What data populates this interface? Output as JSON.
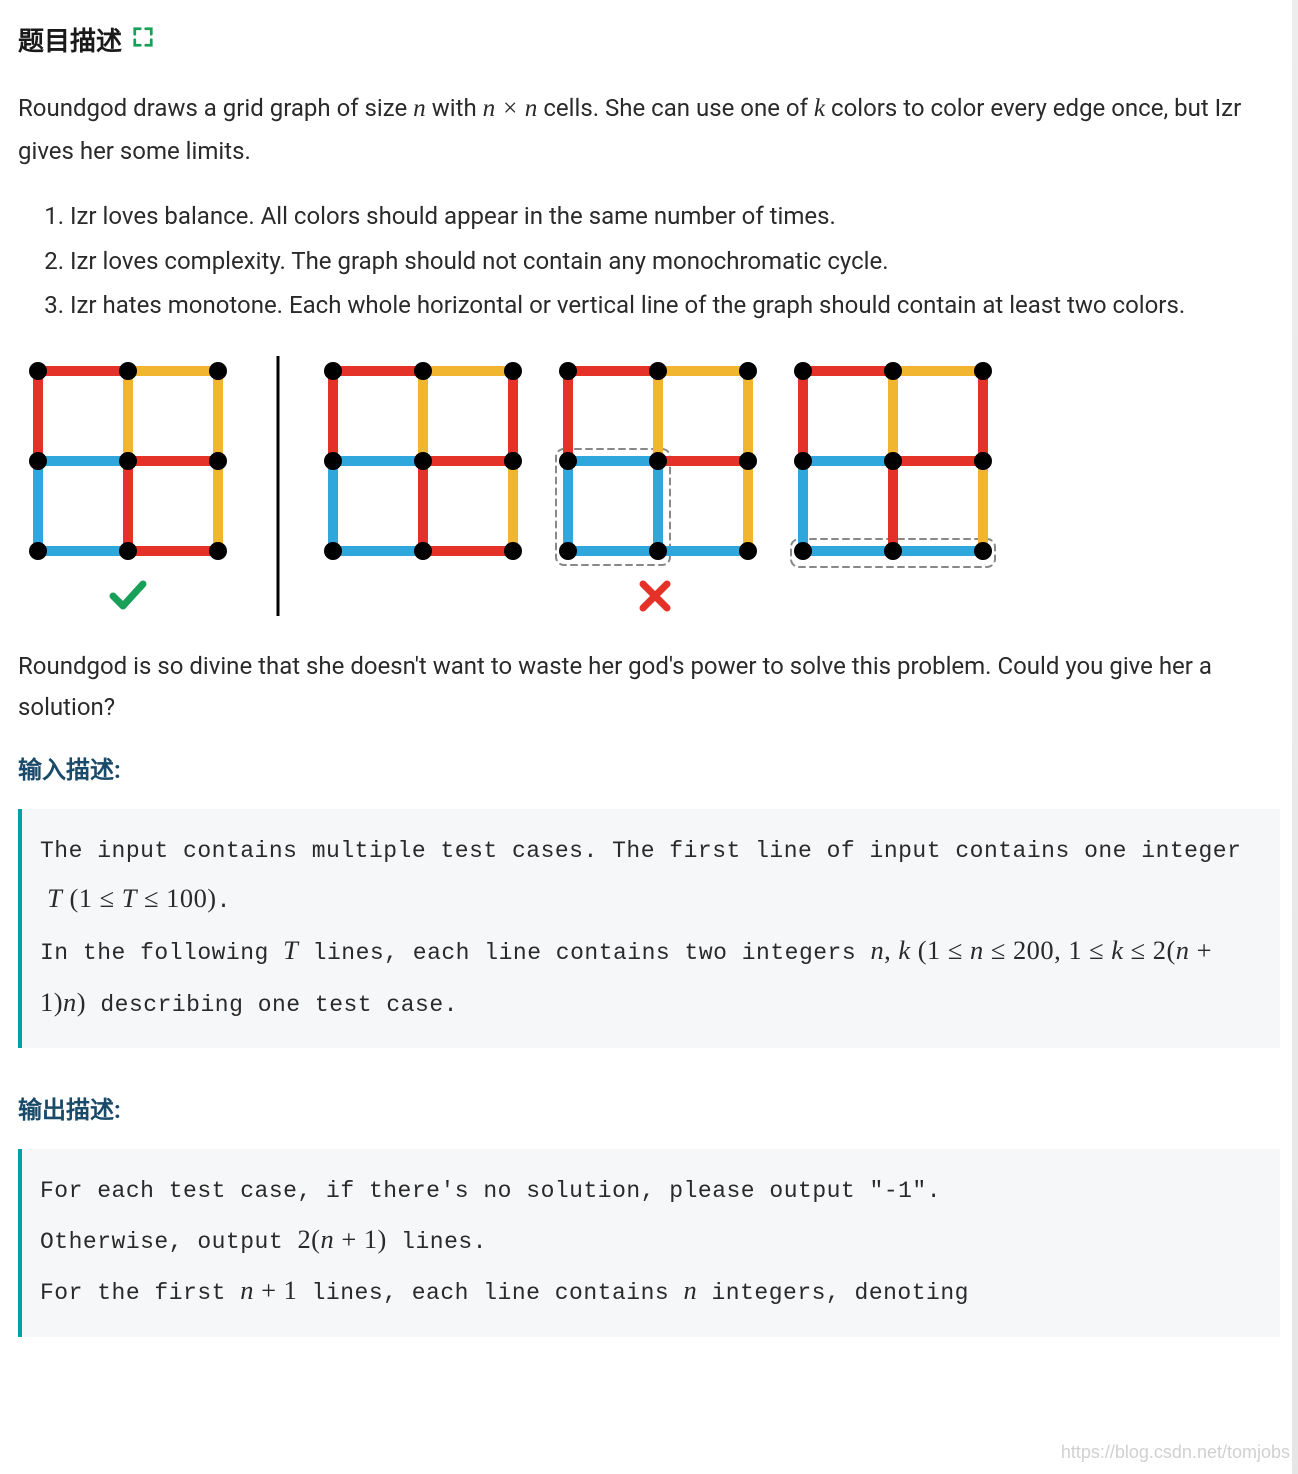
{
  "header": {
    "title": "题目描述"
  },
  "intro": {
    "t1": "Roundgod draws a grid graph of size ",
    "t2": " with ",
    "t3": " cells. She can use one of ",
    "t4": " colors to color every edge once, but Izr gives her some limits.",
    "n": "n",
    "times": "n × n",
    "k": "k"
  },
  "rules": [
    "Izr loves balance. All colors should appear in the same number of times.",
    "Izr loves complexity. The graph should not contain any monochromatic cycle.",
    "Izr hates monotone. Each whole horizontal or vertical line of the graph should contain at least two colors."
  ],
  "after": "Roundgod is so divine that she doesn't want to waste her god's power to solve this problem. Could you give her a solution?",
  "input_heading": "输入描述:",
  "output_heading": "输出描述:",
  "input": {
    "l1a": "The input contains multiple test cases. The first line of input contains one integer ",
    "l1m": "T (1 ≤ T ≤ 100)",
    "l1b": ".",
    "l2a": "In the following ",
    "l2m1": "T",
    "l2b": " lines, each line contains two integers ",
    "l2m2": "n, k (1 ≤ n ≤ 200, 1 ≤ k ≤ 2(n + 1)n)",
    "l2c": " describing one test case."
  },
  "output": {
    "l1": "For each test case, if there's no solution, please output \"-1\".",
    "l2a": "Otherwise, output ",
    "l2m": "2(n + 1)",
    "l2b": " lines.",
    "l3a": "For the first ",
    "l3m1": "n + 1",
    "l3b": " lines, each line contains ",
    "l3m2": "n",
    "l3c": " integers, denoting"
  },
  "watermark": "https://blog.csdn.net/tomjobs",
  "chart_data": {
    "type": "diagram",
    "description": "Four 2x2 grid-graph colorings; leftmost is valid (green check), right group of three is invalid (red X)",
    "colors": {
      "red": "#e43228",
      "yellow": "#f2b530",
      "blue": "#2fa6dc"
    },
    "grids": [
      {
        "label": "valid",
        "h": [
          [
            "red",
            "yellow"
          ],
          [
            "blue",
            "red"
          ],
          [
            "blue",
            "red"
          ]
        ],
        "v": [
          [
            "red",
            "yellow",
            "yellow"
          ],
          [
            "blue",
            "red",
            "yellow"
          ]
        ]
      },
      {
        "label": "invalid-1",
        "h": [
          [
            "red",
            "yellow"
          ],
          [
            "blue",
            "red"
          ],
          [
            "blue",
            "red"
          ]
        ],
        "v": [
          [
            "red",
            "yellow",
            "red"
          ],
          [
            "blue",
            "red",
            "yellow"
          ]
        ]
      },
      {
        "label": "invalid-2",
        "h": [
          [
            "red",
            "yellow"
          ],
          [
            "blue",
            "red"
          ],
          [
            "blue",
            "blue"
          ]
        ],
        "v": [
          [
            "red",
            "yellow",
            "yellow"
          ],
          [
            "blue",
            "blue",
            "yellow"
          ]
        ],
        "highlight_box": "bottom-left-cell"
      },
      {
        "label": "invalid-3",
        "h": [
          [
            "red",
            "yellow"
          ],
          [
            "blue",
            "red"
          ],
          [
            "blue",
            "blue"
          ]
        ],
        "v": [
          [
            "red",
            "yellow",
            "red"
          ],
          [
            "blue",
            "red",
            "yellow"
          ]
        ],
        "highlight_box": "bottom-row"
      }
    ]
  }
}
